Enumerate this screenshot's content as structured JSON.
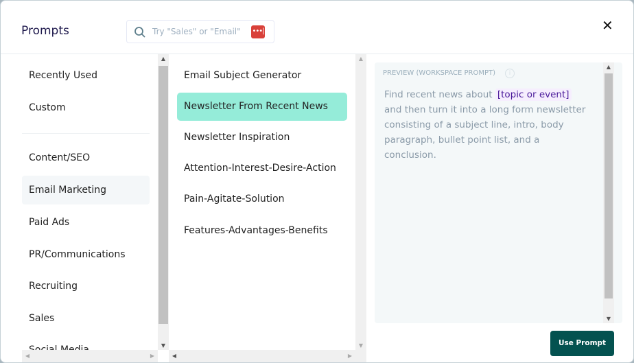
{
  "header": {
    "title": "Prompts",
    "search_placeholder": "Try \"Sales\" or \"Email\"",
    "badge_icon": "ellipsis-badge",
    "close": "✕"
  },
  "categories": [
    {
      "label": "Recently Used"
    },
    {
      "label": "Custom"
    },
    {
      "label": "Content/SEO"
    },
    {
      "label": "Email Marketing",
      "selected": true
    },
    {
      "label": "Paid Ads"
    },
    {
      "label": "PR/Communications"
    },
    {
      "label": "Recruiting"
    },
    {
      "label": "Sales"
    },
    {
      "label": "Social Media"
    }
  ],
  "prompts": [
    {
      "label": "Email Subject Generator"
    },
    {
      "label": "Newsletter From Recent News",
      "selected": true
    },
    {
      "label": "Newsletter Inspiration"
    },
    {
      "label": "Attention-Interest-Desire-Action"
    },
    {
      "label": "Pain-Agitate-Solution"
    },
    {
      "label": "Features-Advantages-Benefits"
    }
  ],
  "preview": {
    "label": "PREVIEW (WORKSPACE PROMPT)",
    "info_icon": "i",
    "text_before": "Find recent news about ",
    "variable": "[topic or event]",
    "text_after": " and then turn it into a long form newsletter consisting of a subject line, intro, body paragraph, bullet point list, and a conclusion."
  },
  "use_prompt_label": "Use Prompt",
  "colors": {
    "accent": "#045250",
    "selected_prompt": "#95ecd9",
    "variable_text": "#4a1a9a"
  }
}
